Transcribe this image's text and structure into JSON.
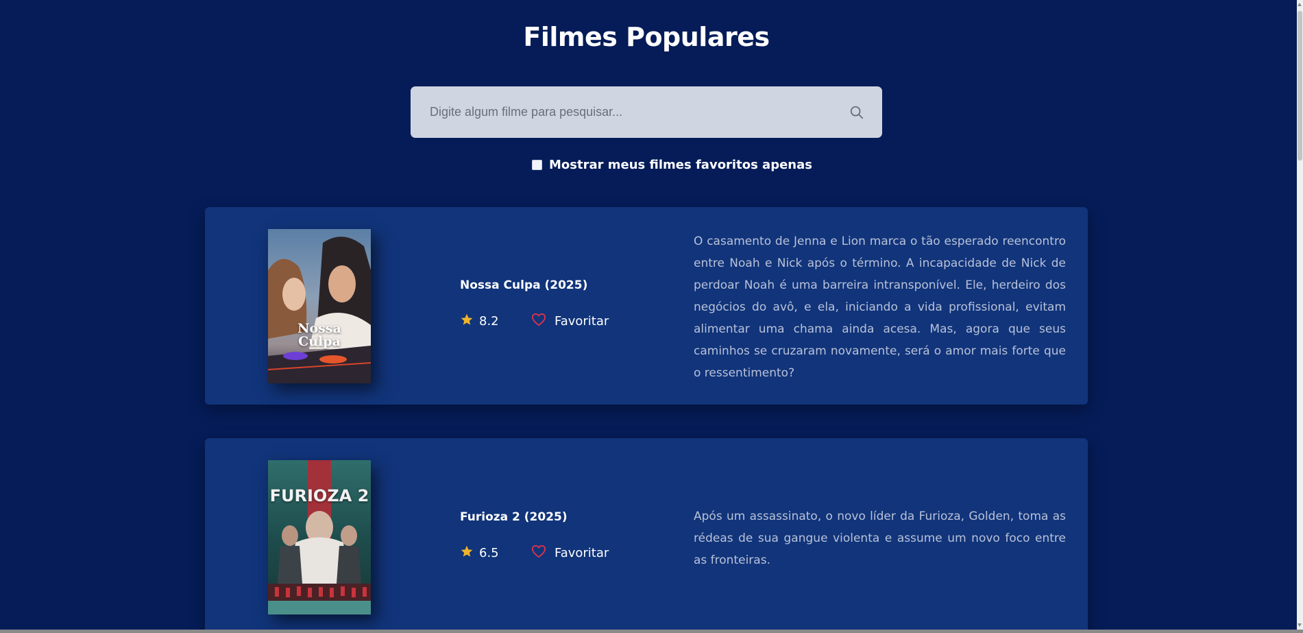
{
  "header": {
    "title": "Filmes Populares"
  },
  "search": {
    "placeholder": "Digite algum filme para pesquisar...",
    "icon": "search-icon"
  },
  "favorites_filter": {
    "label": "Mostrar meus filmes favoritos apenas",
    "checked": false
  },
  "movies": [
    {
      "title": "Nossa Culpa (2025)",
      "rating": "8.2",
      "favorite_label": "Favoritar",
      "poster_text": [
        "Nossa",
        "Culpa"
      ],
      "description": "O casamento de Jenna e Lion marca o tão esperado reencontro entre Noah e Nick após o término. A incapacidade de Nick de perdoar Noah é uma barreira intransponível. Ele, herdeiro dos negócios do avô, e ela, iniciando a vida profissional, evitam alimentar uma chama ainda acesa. Mas, agora que seus caminhos se cruzaram novamente, será o amor mais forte que o ressentimento?"
    },
    {
      "title": "Furioza 2 (2025)",
      "rating": "6.5",
      "favorite_label": "Favoritar",
      "poster_text": [
        "FURIOZA 2"
      ],
      "description": "Após um assassinato, o novo líder da Furioza, Golden, toma as rédeas de sua gangue violenta e assume um novo foco entre as fronteiras."
    }
  ],
  "colors": {
    "background": "#051c58",
    "card": "#11347a",
    "star": "#f0b429",
    "heart": "#e0334d",
    "search_bg": "#cfd5e1"
  }
}
